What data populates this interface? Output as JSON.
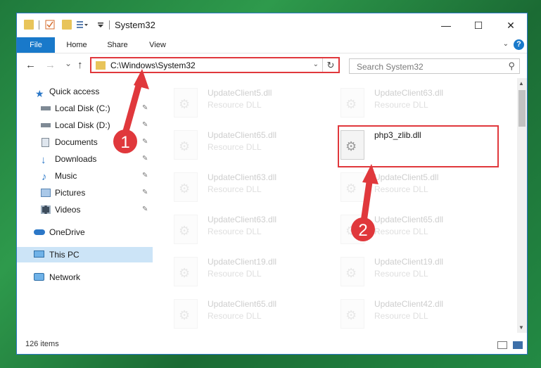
{
  "window": {
    "title": "System32",
    "controls": {
      "minimize": "—",
      "maximize": "☐",
      "close": "✕"
    }
  },
  "ribbon": {
    "tabs": [
      {
        "label": "File",
        "active": true
      },
      {
        "label": "Home"
      },
      {
        "label": "Share"
      },
      {
        "label": "View"
      }
    ],
    "help": "?"
  },
  "navbar": {
    "back": "←",
    "forward": "→",
    "recent": "⌄",
    "up": "↑",
    "address": "C:\\Windows\\System32",
    "refresh": "↻",
    "search_placeholder": "Search System32"
  },
  "sidebar": {
    "items": [
      {
        "label": "Quick access",
        "icon": "star-icon",
        "pinned": false
      },
      {
        "label": "Local Disk (C:)",
        "icon": "drive-icon",
        "pinned": true
      },
      {
        "label": "Local Disk (D:)",
        "icon": "drive-icon",
        "pinned": true
      },
      {
        "label": "Documents",
        "icon": "documents-icon",
        "pinned": true
      },
      {
        "label": "Downloads",
        "icon": "download-icon",
        "pinned": true
      },
      {
        "label": "Music",
        "icon": "music-icon",
        "pinned": true
      },
      {
        "label": "Pictures",
        "icon": "pictures-icon",
        "pinned": true
      },
      {
        "label": "Videos",
        "icon": "videos-icon",
        "pinned": true
      },
      {
        "label": "OneDrive",
        "icon": "cloud-icon"
      },
      {
        "label": "This PC",
        "icon": "computer-icon",
        "selected": true
      },
      {
        "label": "Network",
        "icon": "network-icon"
      }
    ]
  },
  "files": {
    "left": [
      {
        "name": "UpdateClient5.dll",
        "type": "Resource DLL"
      },
      {
        "name": "UpdateClient65.dll",
        "type": "Resource DLL"
      },
      {
        "name": "UpdateClient63.dll",
        "type": "Resource DLL"
      },
      {
        "name": "UpdateClient63.dll",
        "type": "Resource DLL"
      },
      {
        "name": "UpdateClient19.dll",
        "type": "Resource DLL"
      },
      {
        "name": "UpdateClient65.dll",
        "type": "Resource DLL"
      }
    ],
    "right": [
      {
        "name": "UpdateClient63.dll",
        "type": "Resource DLL"
      },
      {
        "name": "php3_zlib.dll",
        "type": "",
        "highlighted": true
      },
      {
        "name": "UpdateClient5.dll",
        "type": "Resource DLL"
      },
      {
        "name": "UpdateClient65.dll",
        "type": "Resource DLL"
      },
      {
        "name": "UpdateClient19.dll",
        "type": "Resource DLL"
      },
      {
        "name": "UpdateClient42.dll",
        "type": "Resource DLL"
      }
    ]
  },
  "status": {
    "item_count": "126 items"
  },
  "annotations": [
    {
      "number": "1",
      "color": "#e0383c"
    },
    {
      "number": "2",
      "color": "#e0383c"
    }
  ]
}
